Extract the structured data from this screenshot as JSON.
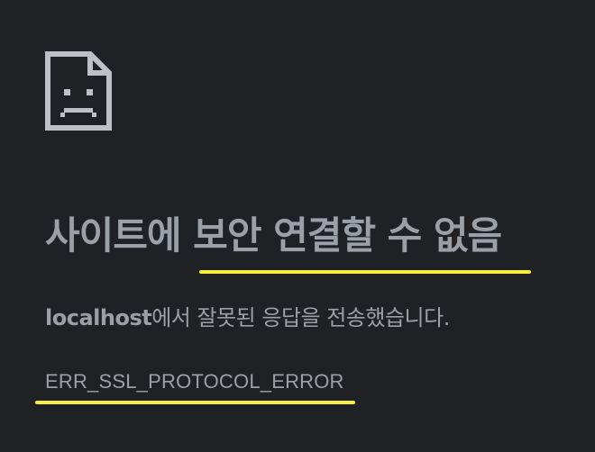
{
  "error_page": {
    "icon": "sad-document-icon",
    "heading": "사이트에 보안 연결할 수 없음",
    "message": {
      "host": "localhost",
      "text": "에서 잘못된 응답을 전송했습니다."
    },
    "error_code": "ERR_SSL_PROTOCOL_ERROR"
  },
  "colors": {
    "background": "#202124",
    "text": "#9aa0a6",
    "icon": "#bdc1c6",
    "highlight_underline": "#f3ef3a"
  }
}
